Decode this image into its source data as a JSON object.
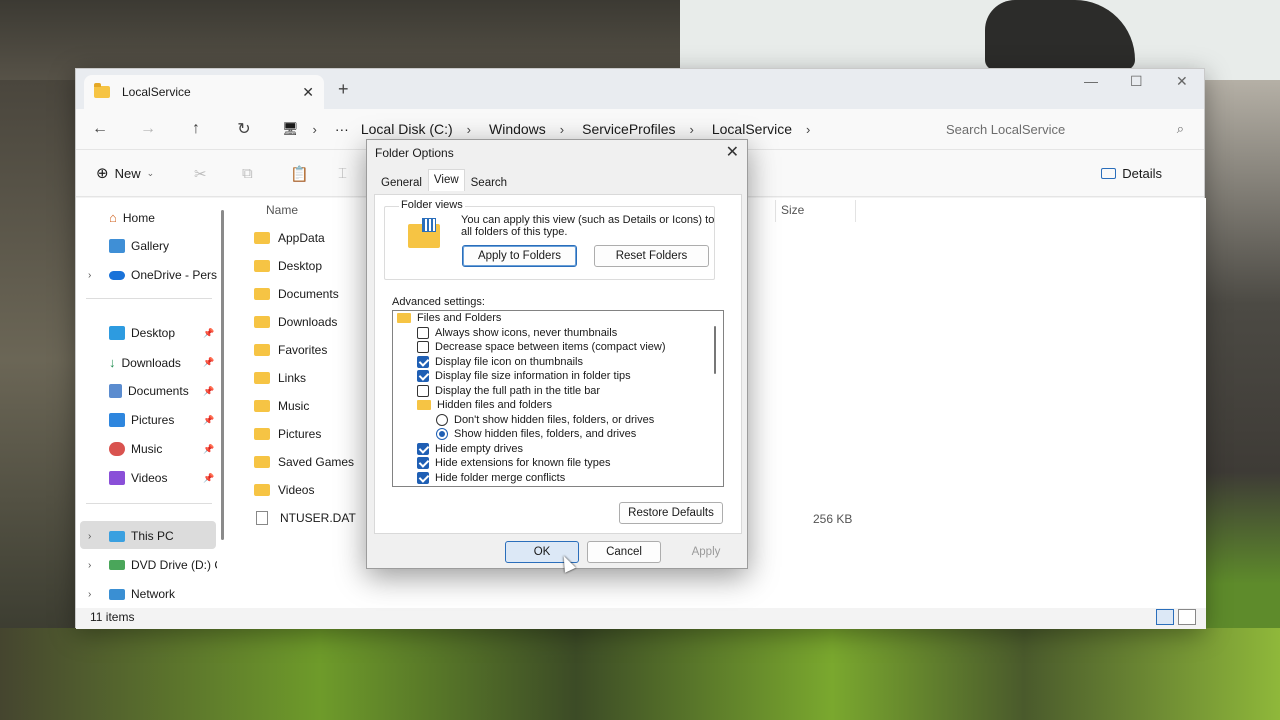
{
  "window": {
    "tab_title": "LocalService",
    "new_tab": "+",
    "address": [
      "Local Disk (C:)",
      "Windows",
      "ServiceProfiles",
      "LocalService"
    ],
    "search_placeholder": "Search LocalService",
    "toolbar": {
      "new_label": "New",
      "details_label": "Details"
    },
    "sidebar": {
      "items": [
        {
          "label": "Home"
        },
        {
          "label": "Gallery"
        },
        {
          "label": "OneDrive - Pers"
        },
        {
          "label": "Desktop"
        },
        {
          "label": "Downloads"
        },
        {
          "label": "Documents"
        },
        {
          "label": "Pictures"
        },
        {
          "label": "Music"
        },
        {
          "label": "Videos"
        },
        {
          "label": "This PC"
        },
        {
          "label": "DVD Drive (D:) C"
        },
        {
          "label": "Network"
        }
      ]
    },
    "columns": {
      "name": "Name",
      "size": "Size"
    },
    "files": [
      {
        "name": "AppData"
      },
      {
        "name": "Desktop"
      },
      {
        "name": "Documents"
      },
      {
        "name": "Downloads"
      },
      {
        "name": "Favorites"
      },
      {
        "name": "Links"
      },
      {
        "name": "Music"
      },
      {
        "name": "Pictures"
      },
      {
        "name": "Saved Games"
      },
      {
        "name": "Videos"
      },
      {
        "name": "NTUSER.DAT",
        "size": "256 KB"
      }
    ],
    "status": "11 items"
  },
  "dialog": {
    "title": "Folder Options",
    "tabs": [
      "General",
      "View",
      "Search"
    ],
    "active_tab": "View",
    "folder_views": {
      "label": "Folder views",
      "text": "You can apply this view (such as Details or Icons) to all folders of this type.",
      "apply_btn": "Apply to Folders",
      "reset_btn": "Reset Folders"
    },
    "advanced_label": "Advanced settings:",
    "advanced": [
      {
        "type": "folder",
        "label": "Files and Folders"
      },
      {
        "type": "checkbox",
        "checked": false,
        "label": "Always show icons, never thumbnails"
      },
      {
        "type": "checkbox",
        "checked": false,
        "label": "Decrease space between items (compact view)"
      },
      {
        "type": "checkbox",
        "checked": true,
        "label": "Display file icon on thumbnails"
      },
      {
        "type": "checkbox",
        "checked": true,
        "label": "Display file size information in folder tips"
      },
      {
        "type": "checkbox",
        "checked": false,
        "label": "Display the full path in the title bar"
      },
      {
        "type": "folder",
        "label": "Hidden files and folders"
      },
      {
        "type": "radio",
        "checked": false,
        "label": "Don't show hidden files, folders, or drives"
      },
      {
        "type": "radio",
        "checked": true,
        "label": "Show hidden files, folders, and drives"
      },
      {
        "type": "checkbox",
        "checked": true,
        "label": "Hide empty drives"
      },
      {
        "type": "checkbox",
        "checked": true,
        "label": "Hide extensions for known file types"
      },
      {
        "type": "checkbox",
        "checked": true,
        "label": "Hide folder merge conflicts"
      }
    ],
    "restore_btn": "Restore Defaults",
    "ok_btn": "OK",
    "cancel_btn": "Cancel",
    "apply_btn": "Apply"
  }
}
